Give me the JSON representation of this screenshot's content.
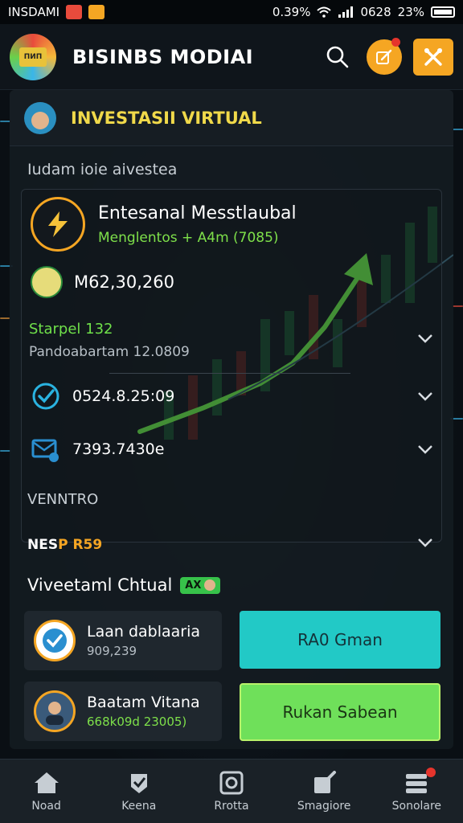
{
  "status_bar": {
    "carrier": "INSDAMI",
    "time": "0.39%",
    "extra": "0628",
    "battery": "23%"
  },
  "app": {
    "logo_text": "ПИΠ",
    "title": "BISINBS MODIAI",
    "search_icon": "search-icon",
    "notify_icon": "edit-icon",
    "settings_icon": "tools-icon"
  },
  "panel": {
    "title": "INVESTASII VIRTUAL",
    "subtitle": "Iudam ioie aivestea",
    "feature": {
      "title": "Entesanal Messtlaubal",
      "subtitle": "Menglentos + A4m (7085)"
    },
    "balance": "M62,30,260",
    "status": {
      "green": "Starpel 132",
      "gray": "Pandoabartam 12.0809"
    },
    "rows": [
      {
        "value": "0524.8.25:09",
        "icon": "check-circle-icon"
      },
      {
        "value": "7393.7430e",
        "icon": "mail-icon"
      }
    ],
    "vendor_label": "VENNTRO",
    "nes_label_white": "NES",
    "nes_label_orange": "P R59",
    "accent_colors": {
      "gold": "#f5a623",
      "green": "#6fe04a",
      "teal": "#22c9c6"
    }
  },
  "virtual": {
    "title": "Viveetaml Chtual",
    "tag": "AX",
    "cards": [
      {
        "name": "Laan dablaaria",
        "value": "909,239"
      },
      {
        "name": "Baatam Vitana",
        "value": "668k09d 23005)"
      }
    ],
    "buttons": [
      {
        "label": "RA0 Gman"
      },
      {
        "label": "Rukan Sabean"
      }
    ]
  },
  "nav": {
    "items": [
      {
        "label": "Noad",
        "icon": "home-icon"
      },
      {
        "label": "Keena",
        "icon": "badge-icon"
      },
      {
        "label": "Rrotta",
        "icon": "camera-icon"
      },
      {
        "label": "Smagiore",
        "icon": "edit-doc-icon"
      },
      {
        "label": "Sonolare",
        "icon": "stack-icon"
      }
    ]
  }
}
